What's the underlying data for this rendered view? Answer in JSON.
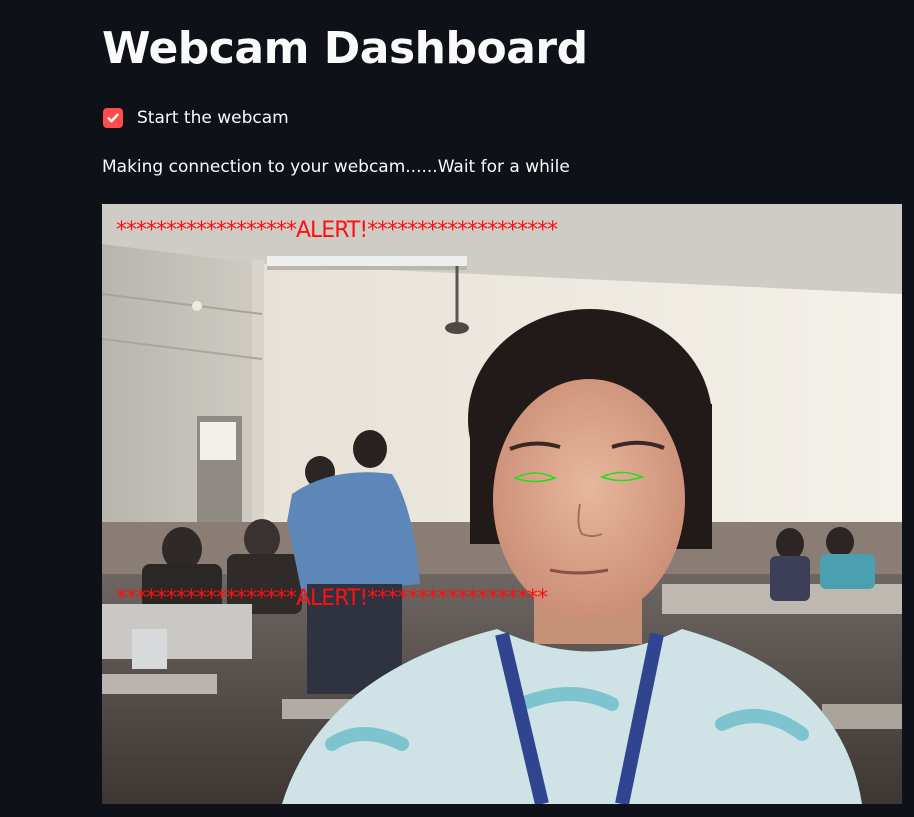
{
  "page": {
    "title": "Webcam Dashboard"
  },
  "webcam_toggle": {
    "label": "Start the webcam",
    "checked": true,
    "accent_color": "#ff4b4b"
  },
  "status": {
    "message": "Making connection to your webcam......Wait for a while"
  },
  "video": {
    "overlay_top": "******************ALERT!*******************",
    "overlay_bottom": "******************ALERT!******************",
    "overlay_color": "#ff1010",
    "eye_contour_color": "#22dd22"
  },
  "theme": {
    "background": "#0e1117",
    "text": "#fafafa"
  }
}
